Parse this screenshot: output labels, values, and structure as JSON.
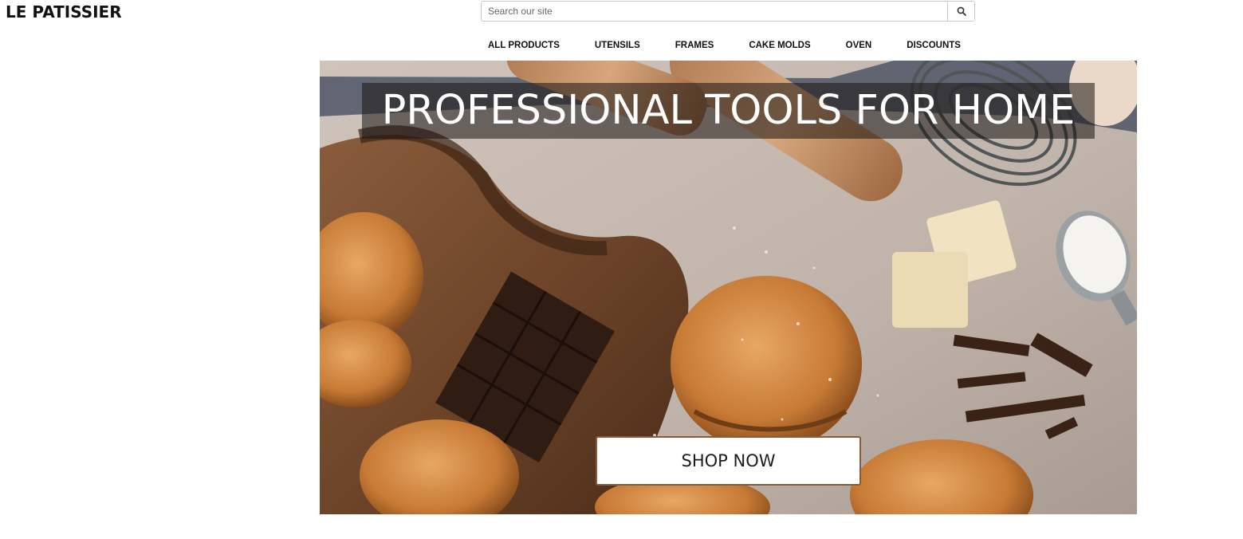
{
  "brand": {
    "logo_text": "LE PATISSIER"
  },
  "search": {
    "placeholder": "Search our site",
    "value": "",
    "icon": "search-icon"
  },
  "nav": {
    "items": [
      {
        "label": "ALL PRODUCTS"
      },
      {
        "label": "UTENSILS"
      },
      {
        "label": "FRAMES"
      },
      {
        "label": "CAKE MOLDS"
      },
      {
        "label": "OVEN"
      },
      {
        "label": "DISCOUNTS"
      }
    ]
  },
  "hero": {
    "title": "PROFESSIONAL TOOLS FOR HOME",
    "cta_label": "SHOP NOW",
    "accent_color": "#8a5a3c"
  }
}
